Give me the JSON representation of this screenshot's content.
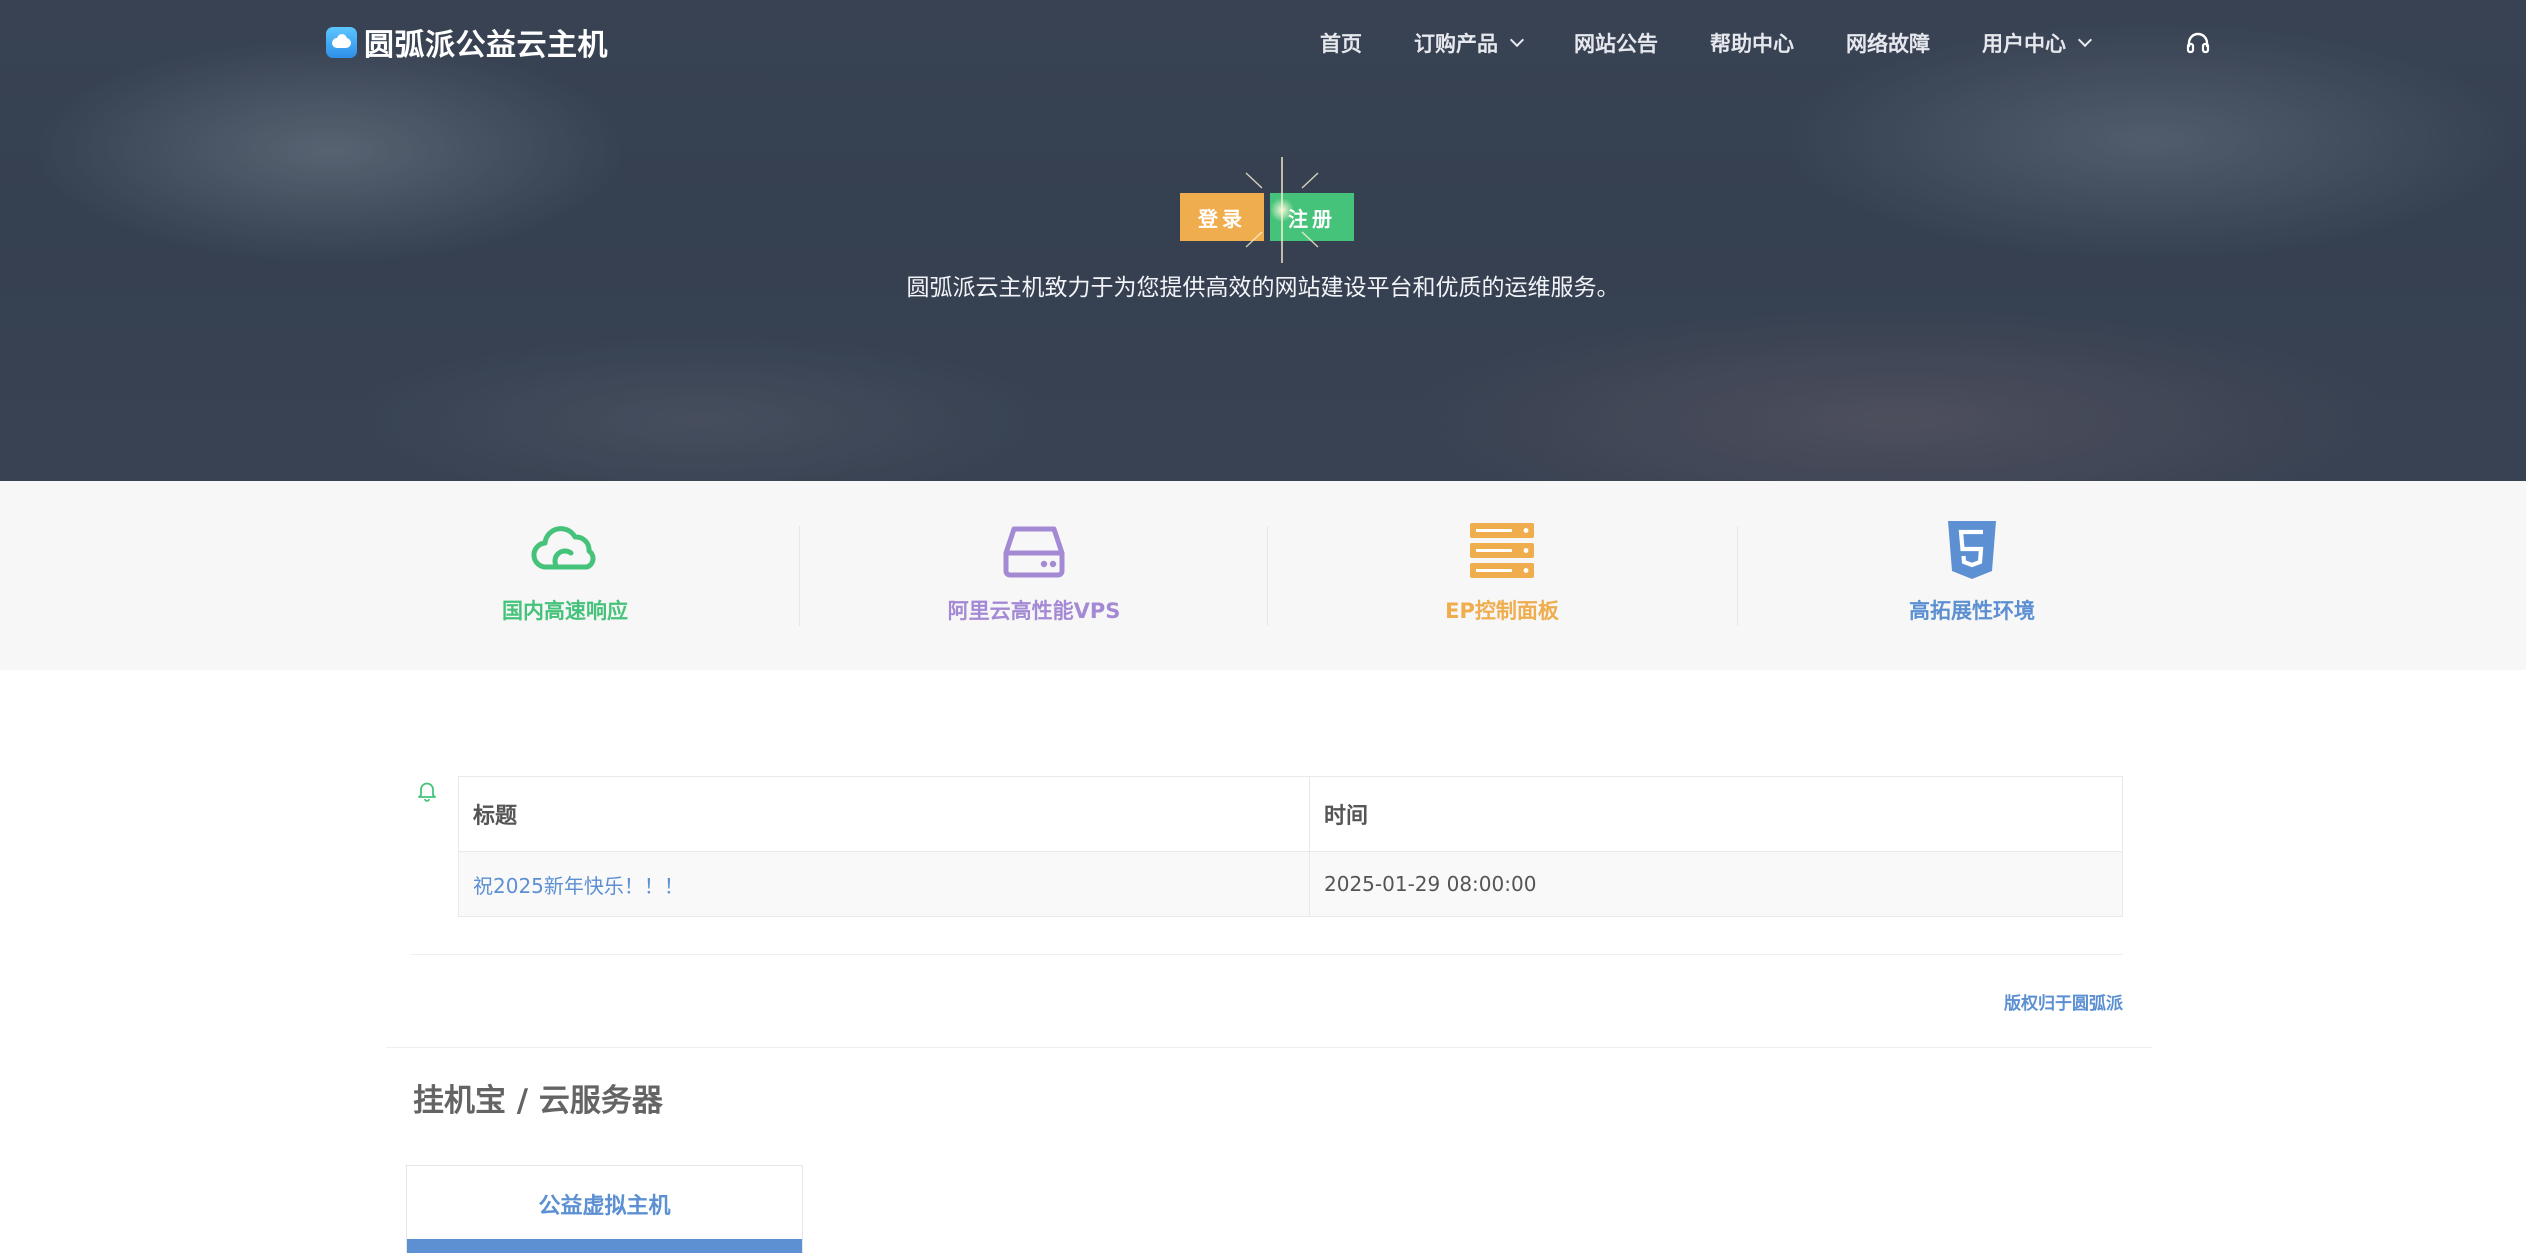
{
  "brand": {
    "name": "圆弧派公益云主机"
  },
  "nav": {
    "items": [
      {
        "label": "首页",
        "has_dropdown": false
      },
      {
        "label": "订购产品",
        "has_dropdown": true
      },
      {
        "label": "网站公告",
        "has_dropdown": false
      },
      {
        "label": "帮助中心",
        "has_dropdown": false
      },
      {
        "label": "网络故障",
        "has_dropdown": false
      },
      {
        "label": "用户中心",
        "has_dropdown": true
      }
    ],
    "support_icon": "headset-icon"
  },
  "hero": {
    "login_label": "登录",
    "register_label": "注册",
    "tagline": "圆弧派云主机致力于为您提供高效的网站建设平台和优质的运维服务。"
  },
  "features": [
    {
      "label": "国内高速响应",
      "icon": "cloud-icon",
      "color": "#46c37b"
    },
    {
      "label": "阿里云高性能VPS",
      "icon": "hard-drive-icon",
      "color": "#a48ad4"
    },
    {
      "label": "EP控制面板",
      "icon": "server-icon",
      "color": "#f0ad4e"
    },
    {
      "label": "高拓展性环境",
      "icon": "html5-icon",
      "color": "#5c90d2"
    }
  ],
  "notices": {
    "icon": "bell-icon",
    "headers": {
      "title": "标题",
      "time": "时间"
    },
    "rows": [
      {
        "title": "祝2025新年快乐！！！",
        "time": "2025-01-29 08:00:00"
      }
    ]
  },
  "footer": {
    "copyright": "版权归于圆弧派"
  },
  "products": {
    "section_title": "挂机宝 / 云服务器",
    "cards": [
      {
        "name": "公益虚拟主机"
      }
    ]
  },
  "colors": {
    "accent_blue": "#5c90d2",
    "green": "#46c37b",
    "orange": "#f0ad4e",
    "purple": "#a48ad4"
  }
}
